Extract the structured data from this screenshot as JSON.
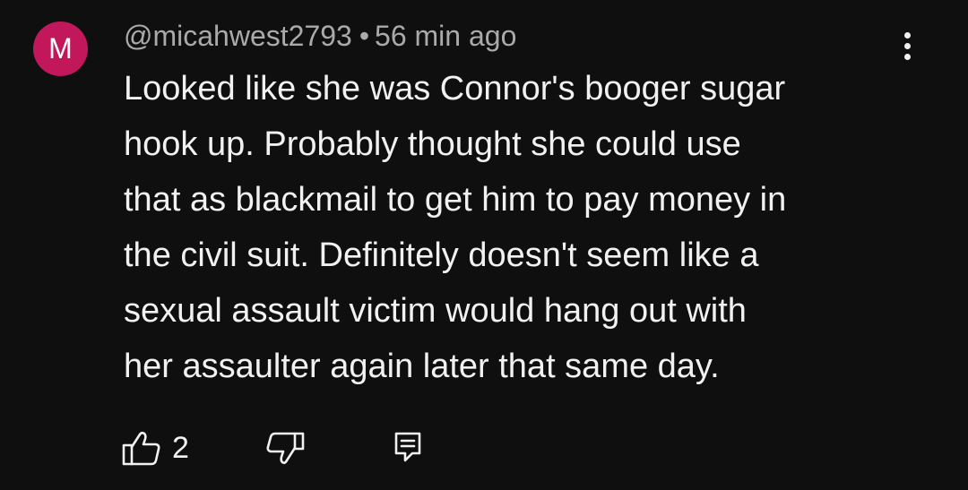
{
  "comment": {
    "avatar_initial": "M",
    "avatar_color": "#c2185b",
    "author": "@micahwest2793",
    "separator": "•",
    "timestamp": "56 min ago",
    "text": "Looked like she was Connor's booger sugar\nhook up. Probably thought she could use\nthat as blackmail to get him to pay money in\nthe civil suit. Definitely doesn't seem like a\nsexual assault victim would hang out with\nher assaulter again later that same day.",
    "like_count": "2",
    "icons": {
      "menu": "more-vertical-icon",
      "like": "thumbs-up-icon",
      "dislike": "thumbs-down-icon",
      "reply": "reply-comment-icon"
    }
  },
  "colors": {
    "background": "#0f0f0f",
    "primary_text": "#f1f1f1",
    "secondary_text": "#aaaaaa"
  }
}
